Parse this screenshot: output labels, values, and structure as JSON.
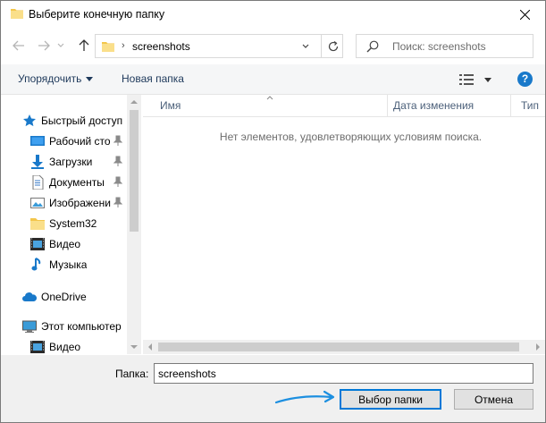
{
  "window": {
    "title": "Выберите конечную папку"
  },
  "address": {
    "separator": "›",
    "current": "screenshots"
  },
  "search": {
    "placeholder": "Поиск: screenshots"
  },
  "toolbar": {
    "organize": "Упорядочить",
    "new_folder": "Новая папка",
    "help": "?"
  },
  "nav": {
    "items": [
      {
        "label": "Быстрый доступ",
        "icon": "star-icon"
      },
      {
        "label": "Рабочий сто",
        "icon": "desktop-icon",
        "pinned": true
      },
      {
        "label": "Загрузки",
        "icon": "download-icon",
        "pinned": true
      },
      {
        "label": "Документы",
        "icon": "documents-icon",
        "pinned": true
      },
      {
        "label": "Изображени",
        "icon": "pictures-icon",
        "pinned": true
      },
      {
        "label": "System32",
        "icon": "folder-icon"
      },
      {
        "label": "Видео",
        "icon": "video-icon"
      },
      {
        "label": "Музыка",
        "icon": "music-icon"
      },
      {
        "label": "OneDrive",
        "icon": "cloud-icon"
      },
      {
        "label": "Этот компьютер",
        "icon": "computer-icon"
      },
      {
        "label": "Видео",
        "icon": "video-icon"
      }
    ]
  },
  "columns": {
    "name": "Имя",
    "date": "Дата изменения",
    "type": "Тип"
  },
  "content": {
    "empty_message": "Нет элементов, удовлетворяющих условиям поиска."
  },
  "footer": {
    "folder_label": "Папка:",
    "folder_value": "screenshots",
    "select_button": "Выбор папки",
    "cancel_button": "Отмена"
  },
  "colors": {
    "accent": "#0078d7",
    "folder": "#f3c64b",
    "toolbar_text": "#1e395b"
  }
}
